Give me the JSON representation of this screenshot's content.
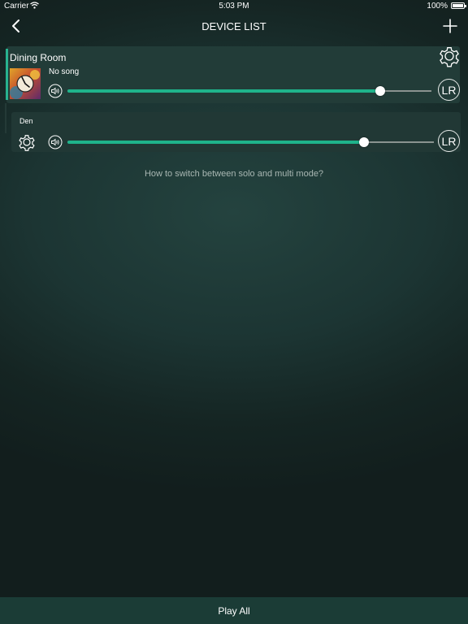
{
  "status_bar": {
    "carrier": "Carrier",
    "time": "5:03 PM",
    "battery": "100%"
  },
  "nav": {
    "title": "DEVICE LIST",
    "back_icon": "chevron-left-icon",
    "add_icon": "plus-icon"
  },
  "devices": [
    {
      "name": "Dining Room",
      "song": "No song",
      "volume": 0.86,
      "channel": "LR"
    },
    {
      "name": "Den",
      "volume": 0.81,
      "channel": "LR"
    }
  ],
  "help_link": "How to switch between solo and multi mode?",
  "play_all": "Play All",
  "colors": {
    "accent": "#28b38f",
    "slider_fill": "#1fb38b",
    "panel": "#223c38"
  }
}
